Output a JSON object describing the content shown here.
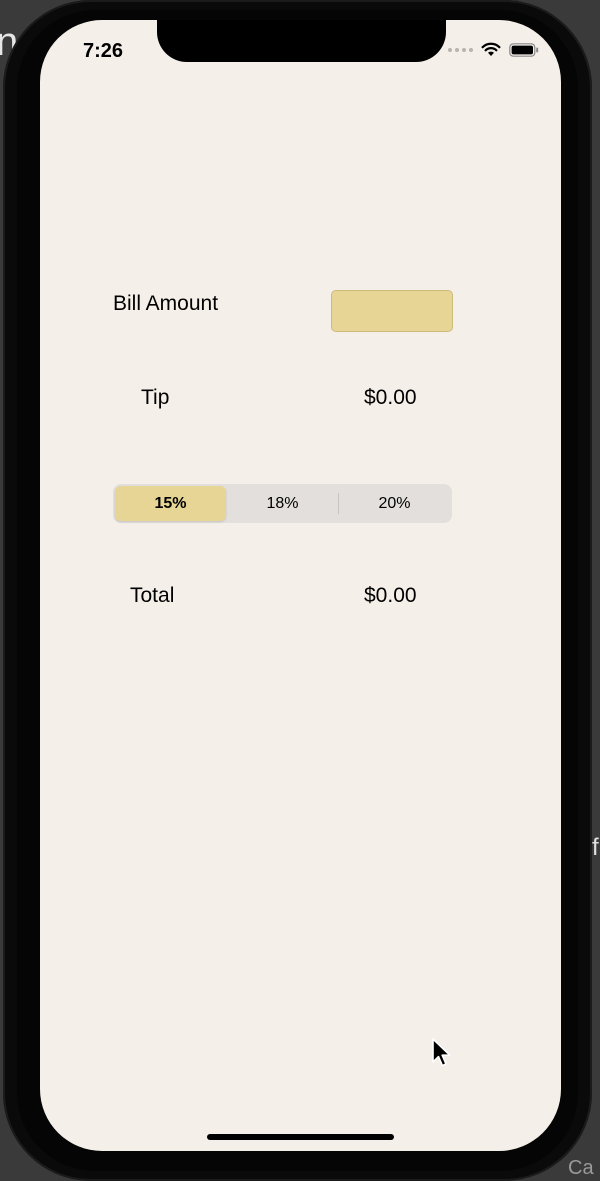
{
  "desktop": {
    "fragments": {
      "top_left": "n",
      "right": "f",
      "bottom_right": "Ca"
    }
  },
  "status_bar": {
    "time": "7:26"
  },
  "form": {
    "bill_amount_label": "Bill Amount",
    "bill_amount_value": "",
    "tip_label": "Tip",
    "tip_value": "$0.00",
    "total_label": "Total",
    "total_value": "$0.00"
  },
  "tip_percentages": {
    "options": [
      "15%",
      "18%",
      "20%"
    ],
    "selected": "15%"
  },
  "colors": {
    "screen_background": "#f4efe9",
    "accent": "#e7d596",
    "segment_track": "#e2dfdc"
  }
}
